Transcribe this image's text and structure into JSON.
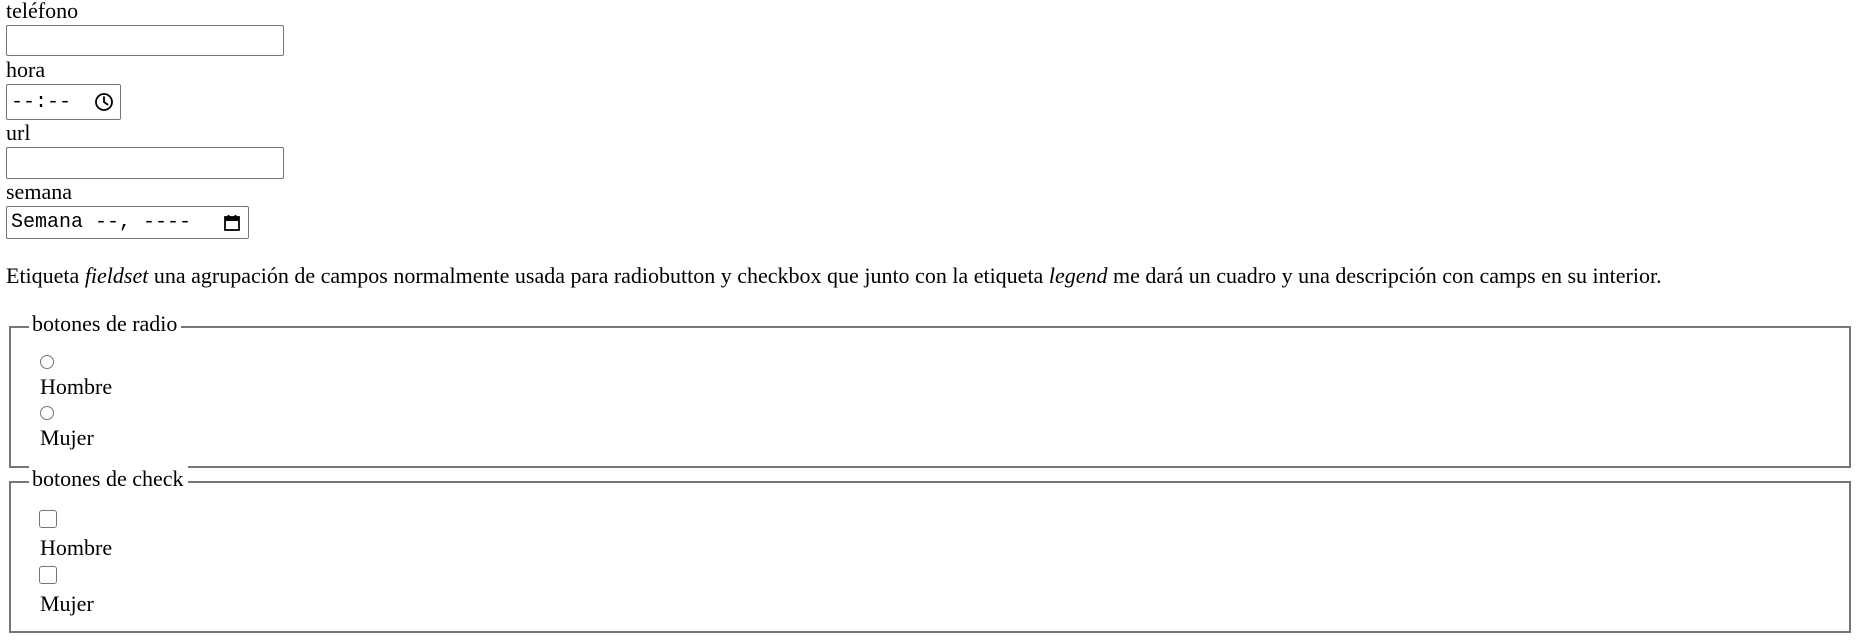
{
  "fields": {
    "telefono": {
      "label": "teléfono",
      "value": ""
    },
    "hora": {
      "label": "hora",
      "placeholder": "--:--"
    },
    "url": {
      "label": "url",
      "value": ""
    },
    "semana": {
      "label": "semana",
      "placeholder": "Semana --, ----"
    }
  },
  "paragraph": {
    "part1": "Etiqueta ",
    "em1": "fieldset",
    "part2": " una agrupación de campos normalmente usada para radiobutton y checkbox que junto con la etiqueta ",
    "em2": "legend",
    "part3": " me dará un cuadro y una descripción con camps en su interior."
  },
  "radio_group": {
    "legend": "botones de radio",
    "options": [
      {
        "label": "Hombre",
        "checked": false
      },
      {
        "label": "Mujer",
        "checked": false
      }
    ]
  },
  "check_group": {
    "legend": "botones de check",
    "options": [
      {
        "label": "Hombre",
        "checked": false
      },
      {
        "label": "Mujer",
        "checked": false
      }
    ]
  },
  "icons": {
    "time_picker": "clock-icon",
    "week_picker": "calendar-icon"
  }
}
